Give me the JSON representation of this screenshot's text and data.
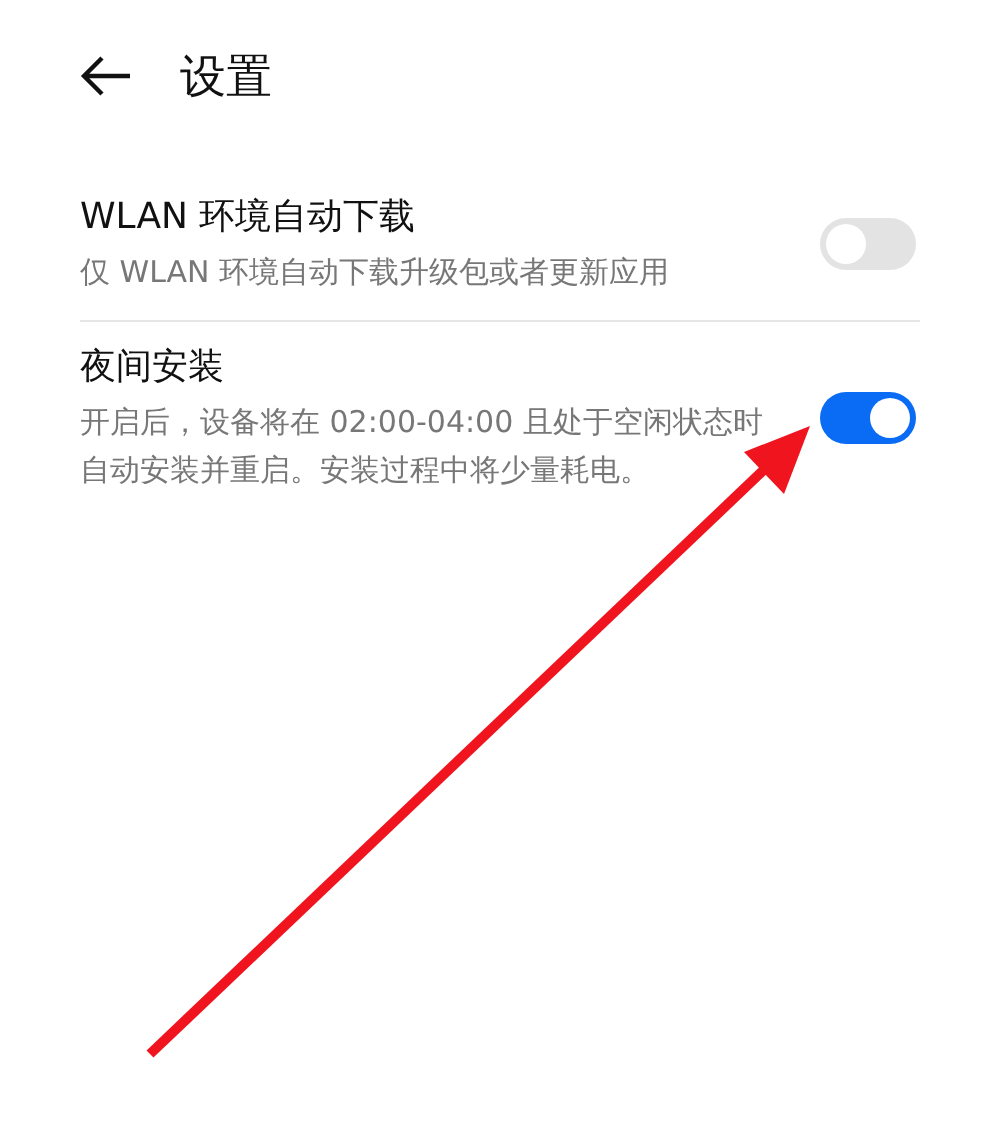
{
  "header": {
    "title": "设置"
  },
  "settings": [
    {
      "title": "WLAN 环境自动下载",
      "description": "仅 WLAN 环境自动下载升级包或者更新应用",
      "on": false
    },
    {
      "title": "夜间安装",
      "description": "开启后，设备将在 02:00-04:00 且处于空闲状态时自动安装并重启。安装过程中将少量耗电。",
      "on": true
    }
  ]
}
